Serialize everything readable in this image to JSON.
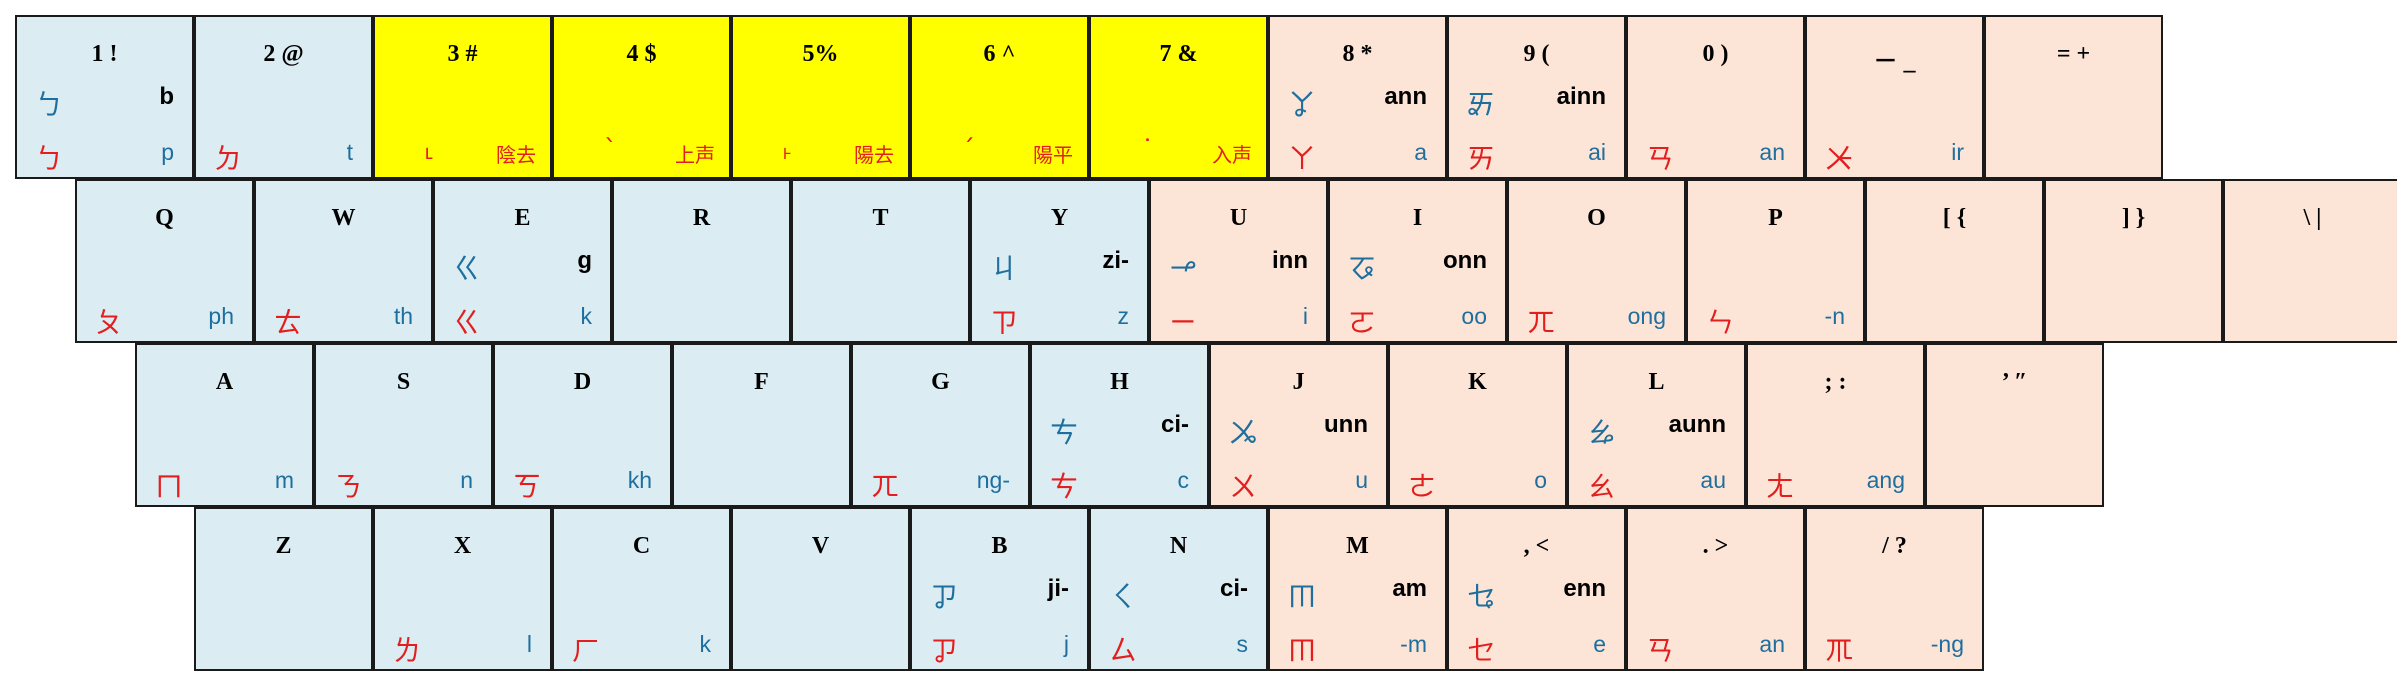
{
  "keyboard": {
    "rows": [
      {
        "keys": [
          {
            "id": "1",
            "label": "1 !",
            "color": "blue",
            "sym1": "ㄅ",
            "rom1": "b",
            "sym2": "ㄅ",
            "rom2": "p"
          },
          {
            "id": "2",
            "label": "2 @",
            "color": "blue",
            "sym2": "ㄉ",
            "rom2": "t"
          },
          {
            "id": "3",
            "label": "3 #",
            "color": "yellow",
            "tone": "˪",
            "tone_name": "陰去"
          },
          {
            "id": "4",
            "label": "4 $",
            "color": "yellow",
            "tone": "ˋ",
            "tone_name": "上声"
          },
          {
            "id": "5",
            "label": "5%",
            "color": "yellow",
            "tone": "˫",
            "tone_name": "陽去"
          },
          {
            "id": "6",
            "label": "6 ^",
            "color": "yellow",
            "tone": "ˊ",
            "tone_name": "陽平"
          },
          {
            "id": "7",
            "label": "7 &",
            "color": "yellow",
            "tone": "˙",
            "tone_name": "入声"
          },
          {
            "id": "8",
            "label": "8 *",
            "color": "peach",
            "sym1": "ㆩ",
            "rom1": "ann",
            "sym2": "ㄚ",
            "rom2": "a"
          },
          {
            "id": "9",
            "label": "9 (",
            "color": "peach",
            "sym1": "ㆮ",
            "rom1": "ainn",
            "sym2": "ㄞ",
            "rom2": "ai"
          },
          {
            "id": "0",
            "label": "0 )",
            "color": "peach",
            "sym2": "ㄢ",
            "rom2": "an"
          },
          {
            "id": "minus",
            "label": "－ _",
            "color": "peach",
            "sym2": "ㆨ",
            "rom2": "ir"
          },
          {
            "id": "equal",
            "label": "= +",
            "color": "peach"
          }
        ]
      },
      {
        "keys": [
          {
            "id": "q",
            "label": "Q",
            "color": "blue",
            "sym2": "ㄆ",
            "rom2": "ph"
          },
          {
            "id": "w",
            "label": "W",
            "color": "blue",
            "sym2": "ㄊ",
            "rom2": "th"
          },
          {
            "id": "e",
            "label": "E",
            "color": "blue",
            "sym1": "ㄍ",
            "rom1": "g",
            "sym2": "ㄍ",
            "rom2": "k"
          },
          {
            "id": "r",
            "label": "R",
            "color": "blue"
          },
          {
            "id": "t",
            "label": "T",
            "color": "blue"
          },
          {
            "id": "y",
            "label": "Y",
            "color": "blue",
            "sym1": "ㄐ",
            "rom1": "zi-",
            "sym2": "ㄗ",
            "rom2": "z"
          },
          {
            "id": "u",
            "label": "U",
            "color": "peach",
            "sym1": "ㆪ",
            "rom1": "inn",
            "sym2": "ㄧ",
            "rom2": "i"
          },
          {
            "id": "i",
            "label": "I",
            "color": "peach",
            "sym1": "ㆧ",
            "rom1": "onn",
            "sym2": "ㄛ",
            "rom2": "oo"
          },
          {
            "id": "o",
            "label": "O",
            "color": "peach",
            "sym2": "ㄫ",
            "rom2": "ong"
          },
          {
            "id": "p",
            "label": "P",
            "color": "peach",
            "sym2": "ㄣ",
            "rom2": "-n"
          },
          {
            "id": "lbracket",
            "label": "[ {",
            "color": "peach"
          },
          {
            "id": "rbracket",
            "label": "] }",
            "color": "peach"
          },
          {
            "id": "backslash",
            "label": "\\ |",
            "color": "peach"
          }
        ]
      },
      {
        "keys": [
          {
            "id": "a",
            "label": "A",
            "color": "blue",
            "sym2": "ㄇ",
            "rom2": "m"
          },
          {
            "id": "s",
            "label": "S",
            "color": "blue",
            "sym2": "ㄋ",
            "rom2": "n"
          },
          {
            "id": "d",
            "label": "D",
            "color": "blue",
            "sym2": "ㄎ",
            "rom2": "kh"
          },
          {
            "id": "f",
            "label": "F",
            "color": "blue"
          },
          {
            "id": "g",
            "label": "G",
            "color": "blue",
            "sym2": "ㄫ",
            "rom2": "ng-"
          },
          {
            "id": "h",
            "label": "H",
            "color": "blue",
            "sym1": "ㄘ",
            "rom1": "ci-",
            "sym2": "ㄘ",
            "rom2": "c"
          },
          {
            "id": "j",
            "label": "J",
            "color": "peach",
            "sym1": "ㆫ",
            "rom1": "unn",
            "sym2": "ㄨ",
            "rom2": "u"
          },
          {
            "id": "k",
            "label": "K",
            "color": "peach",
            "sym2": "ㄜ",
            "rom2": "o"
          },
          {
            "id": "l",
            "label": "L",
            "color": "peach",
            "sym1": "ㆯ",
            "rom1": "aunn",
            "sym2": "ㄠ",
            "rom2": "au"
          },
          {
            "id": "semicolon",
            "label": "; :",
            "color": "peach",
            "sym2": "ㄤ",
            "rom2": "ang"
          },
          {
            "id": "quote",
            "label": "’ ″",
            "color": "peach"
          }
        ]
      },
      {
        "keys": [
          {
            "id": "z",
            "label": "Z",
            "color": "blue"
          },
          {
            "id": "x",
            "label": "X",
            "color": "blue",
            "sym2": "ㄌ",
            "rom2": "l"
          },
          {
            "id": "c",
            "label": "C",
            "color": "blue",
            "sym2": "ㄏ",
            "rom2": "k"
          },
          {
            "id": "v",
            "label": "V",
            "color": "blue"
          },
          {
            "id": "b",
            "label": "B",
            "color": "blue",
            "sym1": "ㆡ",
            "rom1": "ji-",
            "sym2": "ㆡ",
            "rom2": "j"
          },
          {
            "id": "n",
            "label": "N",
            "color": "blue",
            "sym1": "ㄑ",
            "rom1": "ci-",
            "sym2": "ㄙ",
            "rom2": "s"
          },
          {
            "id": "m",
            "label": "M",
            "color": "peach",
            "sym1": "ㆬ",
            "rom1": "am",
            "sym2": "ㆬ",
            "rom2": "-m"
          },
          {
            "id": "comma",
            "label": ", <",
            "color": "peach",
            "sym1": "ㆥ",
            "rom1": "enn",
            "sym2": "ㆤ",
            "rom2": "e"
          },
          {
            "id": "period",
            "label": ". >",
            "color": "peach",
            "sym2": "ㄢ",
            "rom2": "an"
          },
          {
            "id": "slash",
            "label": "/ ?",
            "color": "peach",
            "sym2": "ㆭ",
            "rom2": "-ng"
          }
        ]
      }
    ]
  }
}
